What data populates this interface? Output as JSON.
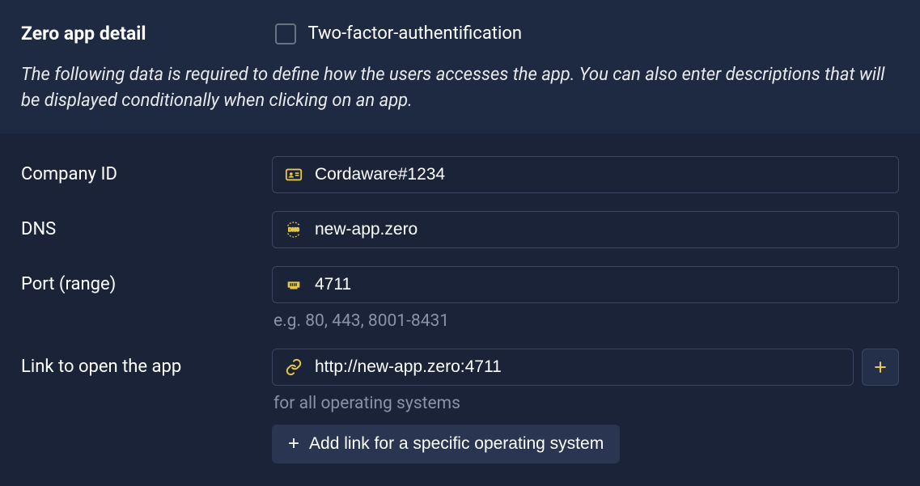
{
  "header": {
    "title": "Zero app detail",
    "twofa_label": "Two-factor-authentification",
    "twofa_checked": false,
    "description": "The following data is required to define how the users accesses the app. You can also enter descriptions that will be displayed conditionally when clicking on an app."
  },
  "form": {
    "company_id": {
      "label": "Company ID",
      "value": "Cordaware#1234"
    },
    "dns": {
      "label": "DNS",
      "value": "new-app.zero"
    },
    "port": {
      "label": "Port (range)",
      "value": "4711",
      "helper": "e.g. 80, 443, 8001-8431"
    },
    "link": {
      "label": "Link to open the app",
      "value": "http://new-app.zero:4711",
      "helper": "for all operating systems",
      "add_specific_label": "Add link for a specific operating system"
    }
  }
}
